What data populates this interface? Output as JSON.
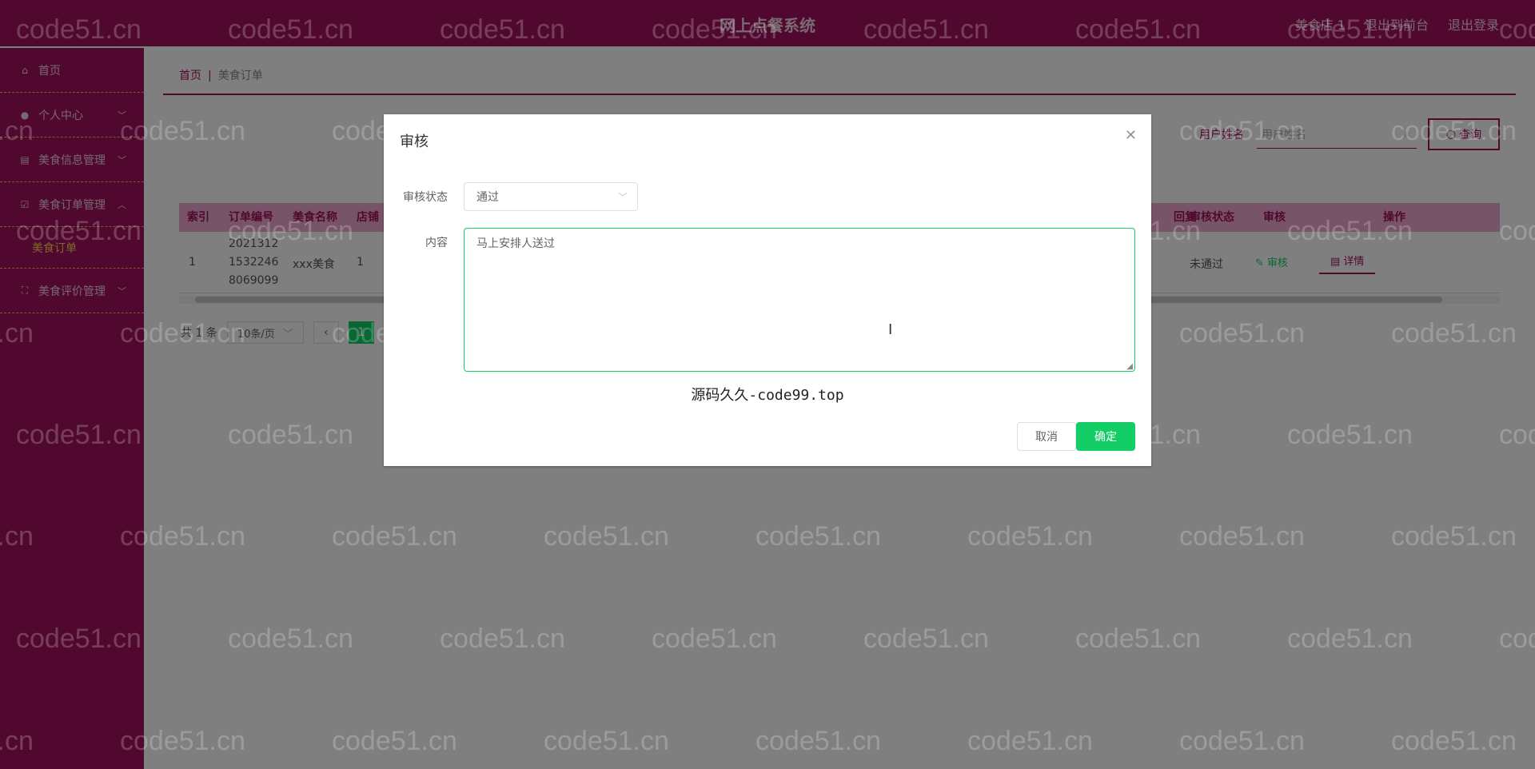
{
  "header": {
    "title": "网上点餐系统",
    "links": [
      "美食店 1",
      "退出到前台",
      "退出登录"
    ]
  },
  "sidebar": {
    "items": [
      {
        "label": "首页",
        "icon": "home-icon"
      },
      {
        "label": "个人中心",
        "icon": "user-icon",
        "arrow": "chevron-down"
      },
      {
        "label": "美食信息管理",
        "icon": "doc-icon",
        "arrow": "chevron-down"
      },
      {
        "label": "美食订单管理",
        "icon": "checkbox-icon",
        "arrow": "chevron-up"
      },
      {
        "label": "美食订单",
        "sub": true
      },
      {
        "label": "美食评价管理",
        "icon": "frame-icon",
        "arrow": "chevron-down"
      }
    ]
  },
  "breadcrumb": {
    "home": "首页",
    "separator": "|",
    "current": "美食订单"
  },
  "search": {
    "label": "用户姓名",
    "placeholder": "用户姓名",
    "button": "查询"
  },
  "table": {
    "headers": [
      "索引",
      "订单编号",
      "美食名称",
      "店铺",
      "回复",
      "审核状态",
      "审核",
      "操作"
    ],
    "row": {
      "index": "1",
      "order_no": [
        "2021312",
        "1532246",
        "8069099"
      ],
      "food_name": "xxx美食",
      "shop": "1",
      "status": "未通过",
      "audit_btn": "审核",
      "detail_btn": "详情"
    }
  },
  "pager": {
    "total": "共 1 条",
    "page_size": "10条/页",
    "current_page": "1"
  },
  "dialog": {
    "title": "审核",
    "status_label": "审核状态",
    "status_value": "通过",
    "content_label": "内容",
    "content_value": "马上安排人送过",
    "source_text": "源码久久-code99.top",
    "cancel": "取消",
    "confirm": "确定"
  },
  "watermark": "code51.cn",
  "colors": {
    "brand": "#a3115f",
    "accent": "#13ce66",
    "highlight": "#f2d74e"
  }
}
